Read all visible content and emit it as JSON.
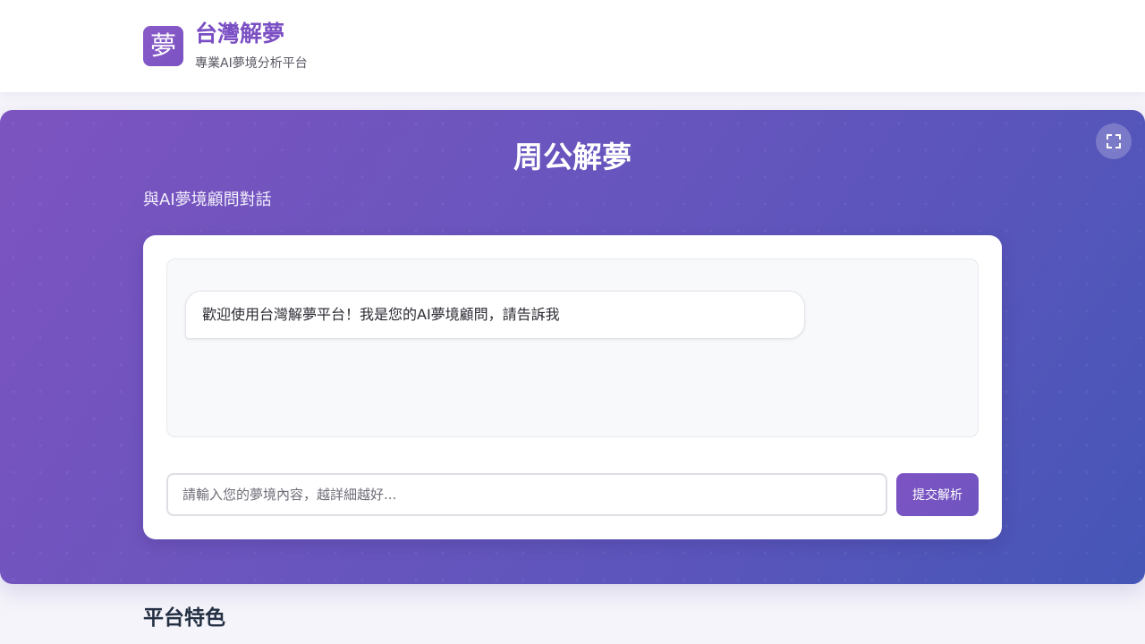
{
  "header": {
    "logo_char": "夢",
    "brand_title": "台灣解夢",
    "brand_subtitle": "專業AI夢境分析平台"
  },
  "hero": {
    "fullscreen_icon": "fullscreen-icon",
    "title": "周公解夢",
    "subtitle": "與AI夢境顧問對話"
  },
  "chat": {
    "messages": [
      {
        "sender": "bot",
        "text": "歡迎使用台灣解夢平台！我是您的AI夢境顧問，請告訴我"
      }
    ],
    "input_placeholder": "請輸入您的夢境內容，越詳細越好...",
    "input_value": "",
    "submit_label": "提交解析"
  },
  "features": {
    "heading": "平台特色"
  },
  "colors": {
    "brand": "#7b4fc4",
    "hero_gradient_start": "#7d54c0",
    "hero_gradient_end": "#4556b7",
    "page_background": "#f5f4fa"
  }
}
